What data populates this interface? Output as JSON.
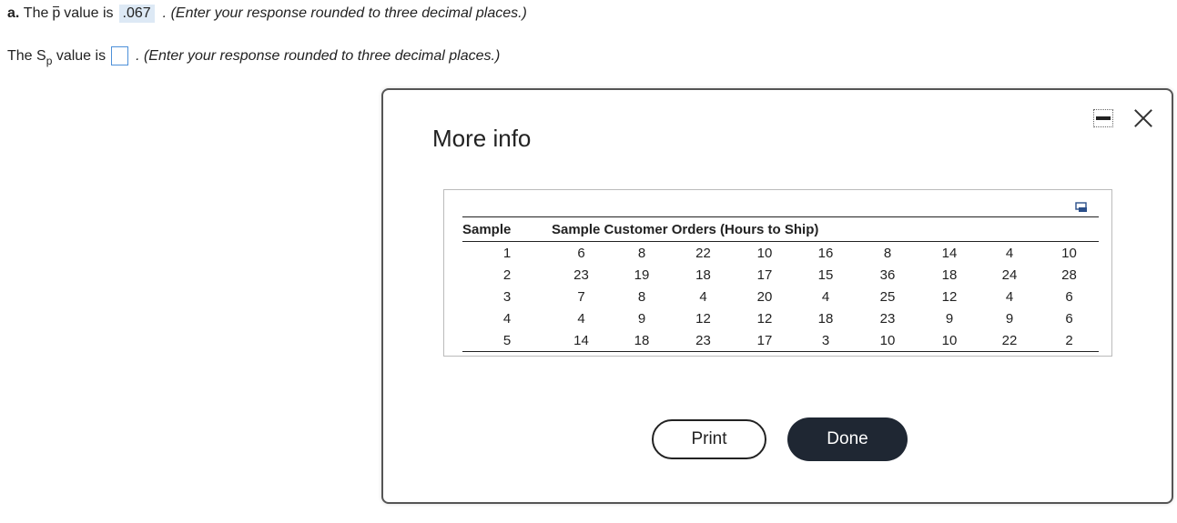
{
  "question": {
    "part_label": "a.",
    "pbar_prefix": "The",
    "pbar_symbol": "p",
    "pbar_suffix": "value is",
    "pbar_answer": ".067",
    "pbar_hint": ". (Enter your response rounded to three decimal places.)",
    "sp_prefix": "The S",
    "sp_subscript": "p",
    "sp_suffix": "value is",
    "sp_answer": "",
    "sp_hint": ". (Enter your response rounded to three decimal places.)"
  },
  "dialog": {
    "title": "More info",
    "icons": {
      "minimize": "minimize-icon",
      "close": "close-icon",
      "copy": "copy-icon"
    },
    "table": {
      "header_sample": "Sample",
      "header_orders": "Sample Customer Orders (Hours to Ship)",
      "rows": [
        [
          "1",
          "6",
          "8",
          "22",
          "10",
          "16",
          "8",
          "14",
          "4",
          "10"
        ],
        [
          "2",
          "23",
          "19",
          "18",
          "17",
          "15",
          "36",
          "18",
          "24",
          "28"
        ],
        [
          "3",
          "7",
          "8",
          "4",
          "20",
          "4",
          "25",
          "12",
          "4",
          "6"
        ],
        [
          "4",
          "4",
          "9",
          "12",
          "12",
          "18",
          "23",
          "9",
          "9",
          "6"
        ],
        [
          "5",
          "14",
          "18",
          "23",
          "17",
          "3",
          "10",
          "10",
          "22",
          "2"
        ]
      ]
    },
    "print_label": "Print",
    "done_label": "Done"
  },
  "colors": {
    "done_bg": "#1f2733",
    "answer_bg": "#dde9f5",
    "input_border": "#4d90d9"
  }
}
